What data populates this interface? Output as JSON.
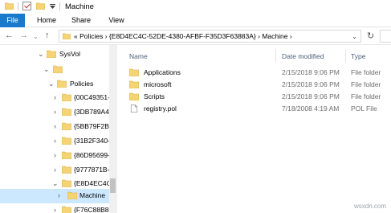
{
  "window": {
    "title": "Machine"
  },
  "ribbon": {
    "tabs": [
      "File",
      "Home",
      "Share",
      "View"
    ]
  },
  "address": {
    "path": "«  Policies  ›  {E8D4EC4C-52DE-4380-AFBF-F35D3F63883A}  ›  Machine  ›"
  },
  "tree": [
    {
      "label": "SysVol",
      "chevron": "open"
    },
    {
      "label": "",
      "chevron": "open"
    },
    {
      "label": "Policies",
      "chevron": "open"
    },
    {
      "label": "{00C49351-",
      "chevron": "closed"
    },
    {
      "label": "{3DB789A4",
      "chevron": "closed"
    },
    {
      "label": "{5BB79F2B-",
      "chevron": "closed"
    },
    {
      "label": "{31B2F340-",
      "chevron": "closed"
    },
    {
      "label": "{86D95699-",
      "chevron": "closed"
    },
    {
      "label": "{9777871B-",
      "chevron": "closed"
    },
    {
      "label": "{E8D4EC4C",
      "chevron": "open"
    },
    {
      "label": "Machine",
      "chevron": "closed",
      "selected": true
    },
    {
      "label": "{F76C88B8-",
      "chevron": "closed"
    }
  ],
  "columns": {
    "name": "Name",
    "date": "Date modified",
    "type": "Type"
  },
  "files": [
    {
      "name": "Applications",
      "date": "2/15/2018 9:06 PM",
      "type": "File folder",
      "icon": "folder-icon"
    },
    {
      "name": "microsoft",
      "date": "2/15/2018 9:06 PM",
      "type": "File folder",
      "icon": "folder-icon"
    },
    {
      "name": "Scripts",
      "date": "2/15/2018 9:06 PM",
      "type": "File folder",
      "icon": "folder-icon"
    },
    {
      "name": "registry.pol",
      "date": "7/18/2008 4:19 AM",
      "type": "POL File",
      "icon": "file-icon"
    }
  ],
  "watermark": "wsxdn.com",
  "colors": {
    "accent": "#1979ca",
    "folder": "#f5d476",
    "selection": "#cce8ff"
  }
}
